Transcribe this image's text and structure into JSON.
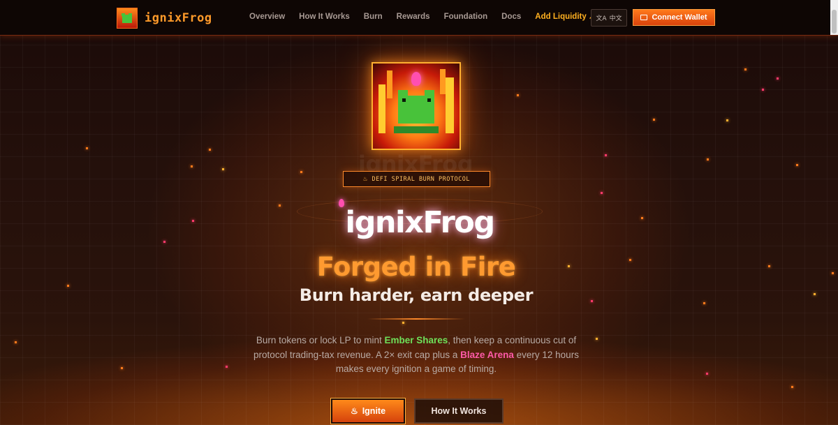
{
  "brand": {
    "name": "ignixFrog",
    "accent": "#ff7a1c",
    "pink": "#ff5aa8",
    "green": "#6ee05a"
  },
  "nav": {
    "links": [
      "Overview",
      "How It Works",
      "Burn",
      "Rewards",
      "Foundation",
      "Docs"
    ],
    "add_liquidity": "Add Liquidity",
    "external_icon": "external-link-icon",
    "language": "中文",
    "language_icon": "translate-icon",
    "connect": "Connect Wallet",
    "connect_icon": "wallet-icon"
  },
  "hero": {
    "ghost_title": "ignixFrog",
    "badge": "DEFI SPIRAL BURN PROTOCOL",
    "badge_icon": "flame-icon",
    "title": "ignixFrog",
    "tagline": "Forged in Fire",
    "subtitle": "Burn harder, earn deeper",
    "desc_1": "Burn tokens or lock LP to mint ",
    "desc_ember": "Ember Shares",
    "desc_2": ", then keep a continuous cut of protocol trading-tax revenue. A 2× exit cap plus a ",
    "desc_blaze": "Blaze Arena",
    "desc_3": " every 12 hours makes every ignition a game of timing.",
    "primary_cta": "Ignite",
    "primary_cta_icon": "flame-icon",
    "secondary_cta": "How It Works"
  }
}
